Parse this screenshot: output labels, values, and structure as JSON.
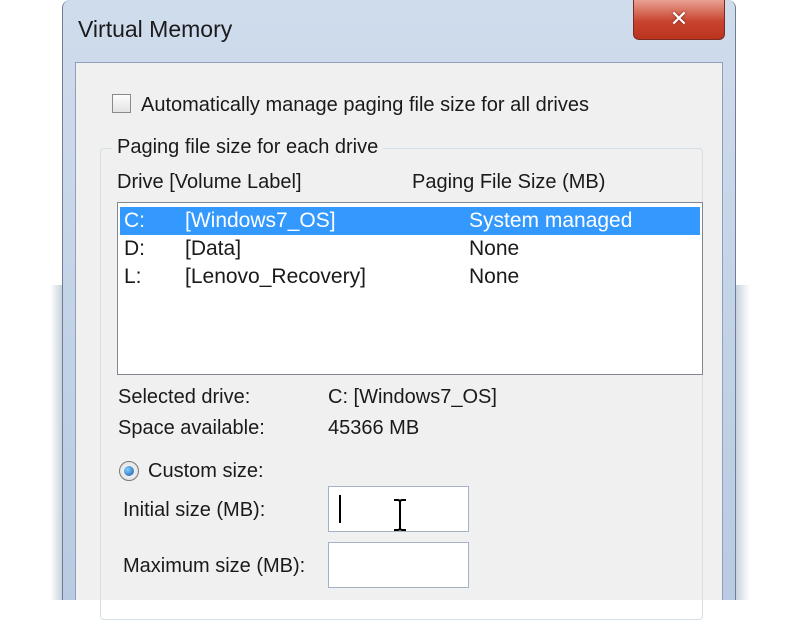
{
  "window": {
    "title": "Virtual Memory",
    "close_glyph": "✕",
    "close_icon": "close-icon"
  },
  "auto_manage": {
    "label": "Automatically manage paging file size for all drives",
    "checked": false
  },
  "paging_group": {
    "legend": "Paging file size for each drive",
    "columns": {
      "drive_label": "Drive  [Volume Label]",
      "size": "Paging File Size (MB)"
    },
    "drives": [
      {
        "drive": "C:",
        "label": "[Windows7_OS]",
        "size": "System managed",
        "selected": true
      },
      {
        "drive": "D:",
        "label": "[Data]",
        "size": "None",
        "selected": false
      },
      {
        "drive": "L:",
        "label": "[Lenovo_Recovery]",
        "size": "None",
        "selected": false
      }
    ],
    "selected_drive_label": "Selected drive:",
    "selected_drive_value": "C:  [Windows7_OS]",
    "space_available_label": "Space available:",
    "space_available_value": "45366 MB",
    "custom_size_label": "Custom size:",
    "custom_size_selected": true,
    "initial_size_label": "Initial size (MB):",
    "initial_size_value": "",
    "maximum_size_label": "Maximum size (MB):",
    "maximum_size_value": ""
  },
  "colors": {
    "selection": "#3399ff",
    "close_button": "#c9442f",
    "frame": "#b9cbe2"
  }
}
